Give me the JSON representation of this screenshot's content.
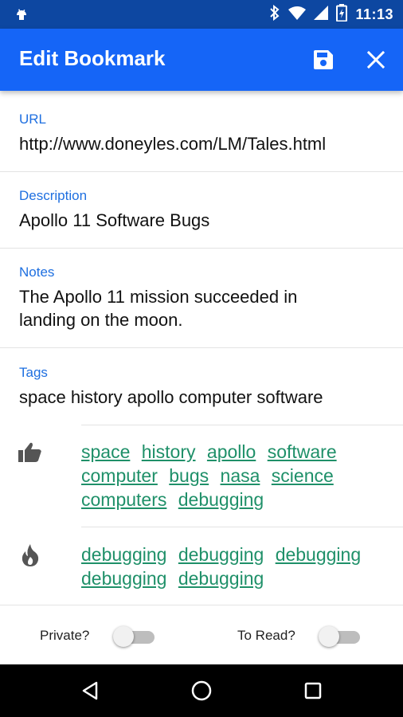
{
  "status_bar": {
    "time": "11:13",
    "icons": [
      "android-icon",
      "bluetooth-icon",
      "wifi-icon",
      "signal-icon",
      "battery-charging-icon"
    ]
  },
  "app_bar": {
    "title": "Edit Bookmark",
    "actions": [
      "save-icon",
      "close-icon"
    ],
    "color": "#1565f7"
  },
  "form": {
    "url": {
      "label": "URL",
      "value": "http://www.doneyles.com/LM/Tales.html"
    },
    "description": {
      "label": "Description",
      "value": "Apollo 11 Software Bugs"
    },
    "notes": {
      "label": "Notes",
      "value": "The Apollo 11 mission succeeded in landing on the moon."
    },
    "tags": {
      "label": "Tags",
      "value": "space history apollo computer software"
    }
  },
  "suggested_tags": {
    "icon": "thumbs-up-icon",
    "items": [
      "space",
      "history",
      "apollo",
      "software",
      "computer",
      "bugs",
      "nasa",
      "science",
      "computers",
      "debugging"
    ]
  },
  "popular_tags": {
    "icon": "flame-icon",
    "items": [
      "debugging",
      "debugging",
      "debugging",
      "debugging",
      "debugging"
    ]
  },
  "toggles": {
    "private": {
      "label": "Private?",
      "on": false
    },
    "to_read": {
      "label": "To Read?",
      "on": false
    }
  },
  "nav_bar": {
    "buttons": [
      "back-icon",
      "home-icon",
      "recents-icon"
    ]
  },
  "colors": {
    "label": "#1e6fe0",
    "tag_link": "#1f9069",
    "status_bar": "#0d47a1"
  }
}
